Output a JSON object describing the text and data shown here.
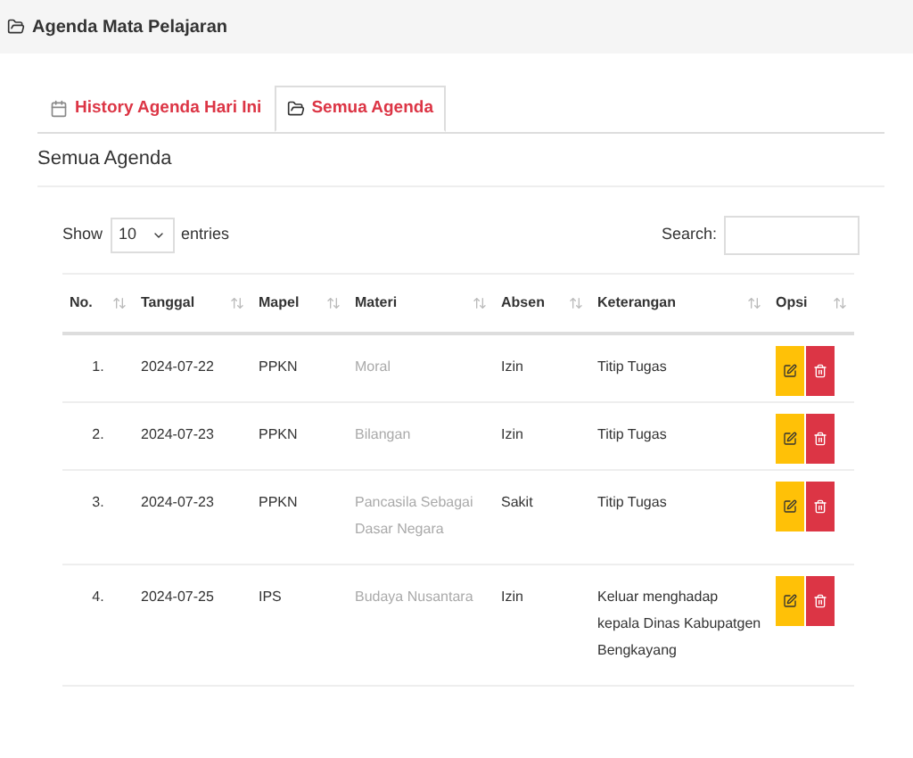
{
  "header": {
    "title": "Agenda Mata Pelajaran"
  },
  "tabs": [
    {
      "label": "History Agenda Hari Ini",
      "kind": "calendar",
      "selected": false
    },
    {
      "label": "Semua Agenda",
      "kind": "folder",
      "selected": true
    }
  ],
  "section_title": "Semua Agenda",
  "length_menu": {
    "show": "Show",
    "value": "10",
    "entries": "entries"
  },
  "search": {
    "label": "Search:"
  },
  "table": {
    "columns": [
      "No.",
      "Tanggal",
      "Mapel",
      "Materi",
      "Absen",
      "Keterangan",
      "Opsi"
    ],
    "rows": [
      {
        "no": "1.",
        "tanggal": "2024-07-22",
        "mapel": "PPKN",
        "materi": "Moral",
        "absen": "Izin",
        "keterangan": "Titip Tugas"
      },
      {
        "no": "2.",
        "tanggal": "2024-07-23",
        "mapel": "PPKN",
        "materi": "Bilangan",
        "absen": "Izin",
        "keterangan": "Titip Tugas"
      },
      {
        "no": "3.",
        "tanggal": "2024-07-23",
        "mapel": "PPKN",
        "materi": "Pancasila Sebagai Dasar Negara",
        "absen": "Sakit",
        "keterangan": "Titip Tugas"
      },
      {
        "no": "4.",
        "tanggal": "2024-07-25",
        "mapel": "IPS",
        "materi": "Budaya Nusantara",
        "absen": "Izin",
        "keterangan": "Keluar menghadap kepala Dinas Kabupatgen Bengkayang"
      }
    ]
  }
}
